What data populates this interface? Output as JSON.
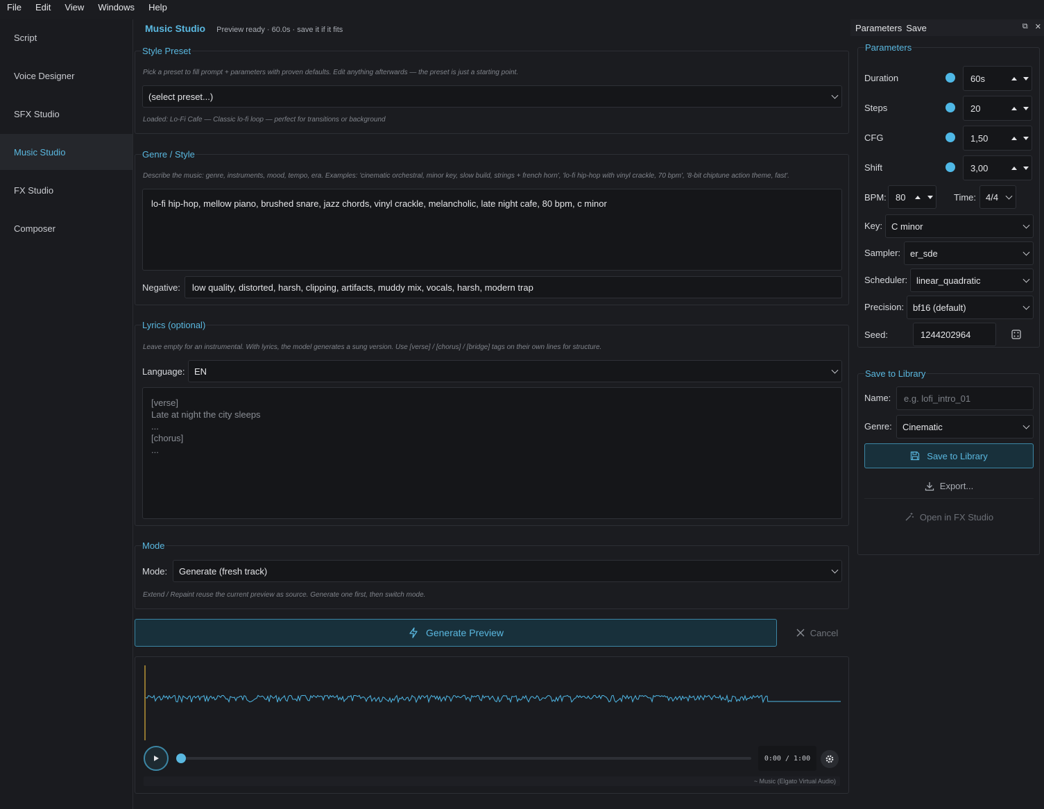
{
  "menu": [
    "File",
    "Edit",
    "View",
    "Windows",
    "Help"
  ],
  "sidebar": {
    "items": [
      {
        "label": "Script"
      },
      {
        "label": "Voice Designer"
      },
      {
        "label": "SFX Studio"
      },
      {
        "label": "Music Studio",
        "active": true
      },
      {
        "label": "FX Studio"
      },
      {
        "label": "Composer"
      }
    ]
  },
  "header": {
    "title": "Music Studio",
    "status": "Preview ready · 60.0s · save it if it fits"
  },
  "style_preset": {
    "title": "Style Preset",
    "hint": "Pick a preset to fill prompt + parameters with proven defaults. Edit anything afterwards — the preset is just a starting point.",
    "selected": "(select preset...)",
    "loaded": "Loaded: Lo-Fi Cafe — Classic lo-fi loop — perfect for transitions or background"
  },
  "genre": {
    "title": "Genre / Style",
    "hint": "Describe the music: genre, instruments, mood, tempo, era. Examples: 'cinematic orchestral, minor key, slow build, strings + french horn', 'lo-fi hip-hop with vinyl crackle, 70 bpm', '8-bit chiptune action theme, fast'.",
    "prompt": "lo-fi hip-hop, mellow piano, brushed snare, jazz chords, vinyl crackle, melancholic, late night cafe, 80 bpm, c minor",
    "negative_label": "Negative:",
    "negative": "low quality, distorted, harsh, clipping, artifacts, muddy mix, vocals, harsh, modern trap"
  },
  "lyrics": {
    "title": "Lyrics (optional)",
    "hint": "Leave empty for an instrumental. With lyrics, the model generates a sung version. Use [verse] / [chorus] / [bridge] tags on their own lines for structure.",
    "language_label": "Language:",
    "language": "EN",
    "placeholder": "[verse]\nLate at night the city sleeps\n...\n[chorus]\n..."
  },
  "mode": {
    "title": "Mode",
    "label": "Mode:",
    "value": "Generate (fresh track)",
    "hint": "Extend / Repaint reuse the current preview as source. Generate one first, then switch mode."
  },
  "actions": {
    "generate": "Generate Preview",
    "cancel": "Cancel"
  },
  "player": {
    "time": "0:00 / 1:00",
    "device": "~ Music (Elgato Virtual Audio)",
    "progress": 0.0,
    "audio_fraction": 0.895
  },
  "panel": {
    "title": "Parameters",
    "save": "Save",
    "params_title": "Parameters",
    "duration_label": "Duration",
    "duration": "60s",
    "steps_label": "Steps",
    "steps": "20",
    "cfg_label": "CFG",
    "cfg": "1,50",
    "shift_label": "Shift",
    "shift": "3,00",
    "bpm_label": "BPM:",
    "bpm": "80",
    "time_label": "Time:",
    "time_sig": "4/4",
    "key_label": "Key:",
    "key": "C minor",
    "sampler_label": "Sampler:",
    "sampler": "er_sde",
    "scheduler_label": "Scheduler:",
    "scheduler": "linear_quadratic",
    "precision_label": "Precision:",
    "precision": "bf16 (default)",
    "seed_label": "Seed:",
    "seed": "1244202964",
    "library_title": "Save to Library",
    "name_label": "Name:",
    "name_placeholder": "e.g. lofi_intro_01",
    "genre_label": "Genre:",
    "genre": "Cinematic",
    "save_library": "Save to Library",
    "export": "Export...",
    "open_fx": "Open in FX Studio"
  },
  "colors": {
    "accent": "#5ab8e0",
    "background": "#1b1c20",
    "waveform": "#4fb8e6",
    "playhead": "#e0b43c"
  }
}
